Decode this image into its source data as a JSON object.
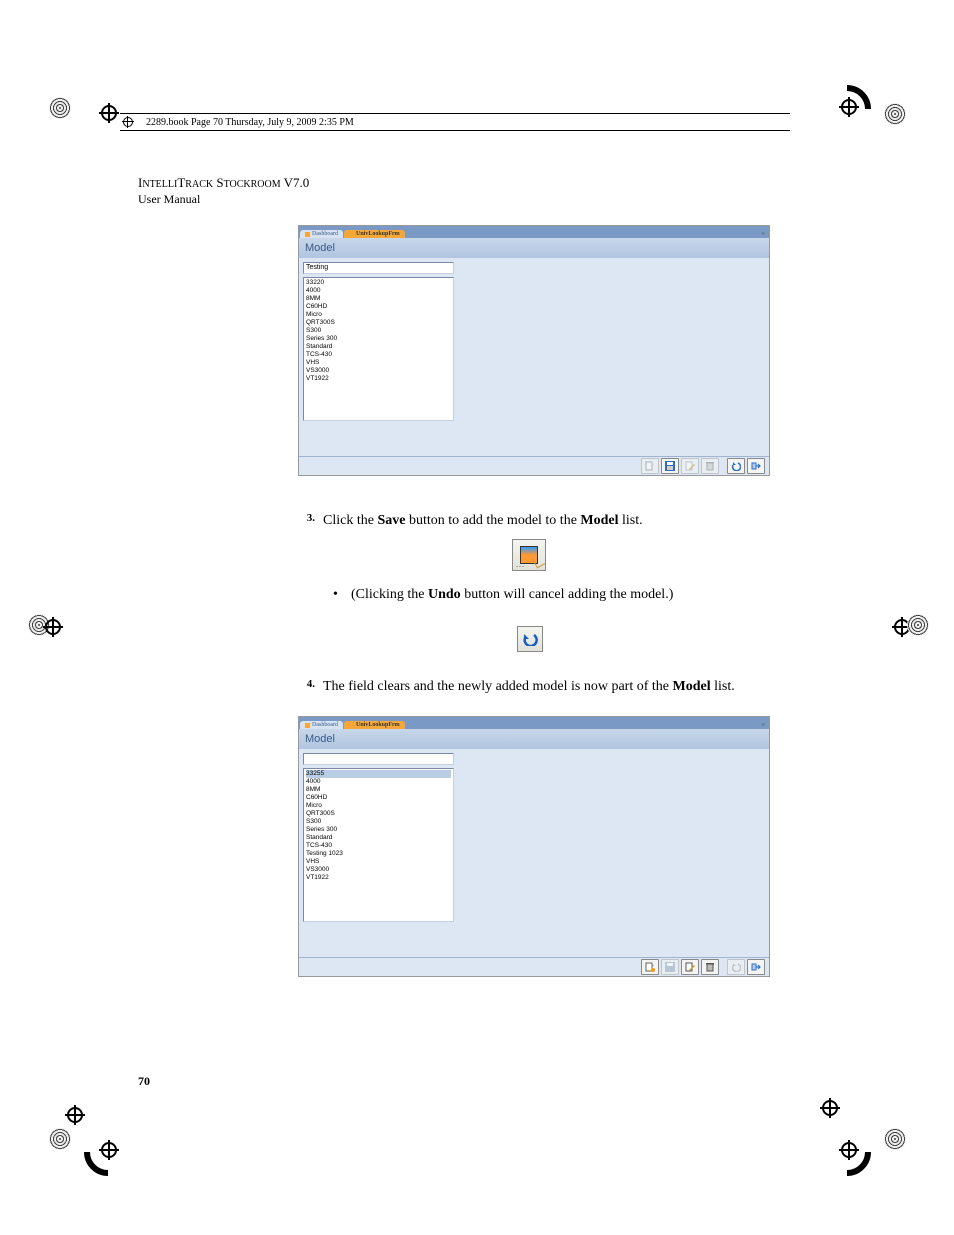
{
  "book_line": "2289.book  Page 70  Thursday, July 9, 2009  2:35 PM",
  "header": {
    "title_pre": "I",
    "title_small1": "NTELLI",
    "title_mid": "T",
    "title_small2": "RACK",
    "title_sp": " S",
    "title_small3": "TOCKROOM",
    "title_ver": " V7.0",
    "subtitle": "User Manual"
  },
  "screenshot1": {
    "tab_inactive": "Dashboard",
    "tab_active": "UnivLookupFrm",
    "panel_title": "Model",
    "input_value": "Testing",
    "list_items": [
      "33220",
      "4000",
      "8MM",
      "C60HD",
      "Micro",
      "QRT300S",
      "S300",
      "Series 300",
      "Standard",
      "TCS-430",
      "VHS",
      "VS3000",
      "VT1922"
    ]
  },
  "step3": {
    "num": "3.",
    "text_pre": "Click the ",
    "text_bold1": "Save",
    "text_mid": " button to add the model to the ",
    "text_bold2": "Model",
    "text_post": " list."
  },
  "bullet": {
    "pre": "(Clicking the ",
    "bold": "Undo",
    "post": " button will cancel adding the model.)"
  },
  "step4": {
    "num": "4.",
    "text_pre": "The field clears and the newly added model is now part of the ",
    "text_bold": "Model",
    "text_post": " list."
  },
  "screenshot2": {
    "tab_inactive": "Dashboard",
    "tab_active": "UnivLookupFrm",
    "panel_title": "Model",
    "input_value": "",
    "selected": "33255",
    "list_items": [
      "33255",
      "4000",
      "8MM",
      "C60HD",
      "Micro",
      "QRT300S",
      "S300",
      "Series 300",
      "Standard",
      "TCS-430",
      "Testing 1023",
      "VHS",
      "VS3000",
      "VT1922"
    ]
  },
  "page_number": "70",
  "toolbar_icons": {
    "new": "new-icon",
    "save": "save-icon",
    "edit": "edit-icon",
    "delete": "delete-icon",
    "undo": "undo-icon",
    "close": "close-icon"
  }
}
